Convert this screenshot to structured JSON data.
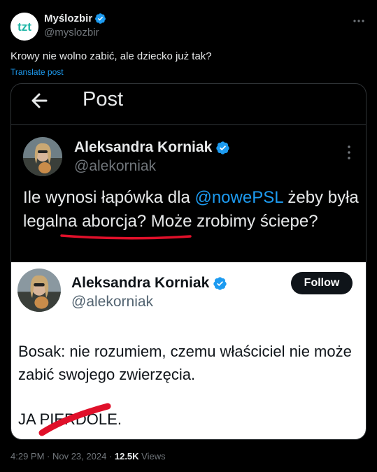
{
  "author": {
    "display_name": "Myślozbir",
    "handle": "@myslozbir",
    "avatar_text": "tzt"
  },
  "tweet": {
    "text": "Krowy nie wolno zabić, ale dziecko już tak?",
    "translate_label": "Translate post"
  },
  "screenshot": {
    "nav_title": "Post",
    "quoted_post": {
      "display_name": "Aleksandra Korniak",
      "handle": "@alekorniak",
      "text_part1": "Ile wynosi łapówka dla ",
      "mention": "@nowePSL",
      "text_part2": " żeby była legalna aborcja? Może zrobimy ściepe?"
    },
    "inner_post": {
      "display_name": "Aleksandra Korniak",
      "handle": "@alekorniak",
      "follow_label": "Follow",
      "text": "Bosak: nie rozumiem, czemu właściciel nie może zabić swojego zwierzęcia.",
      "last_line": "JA PIERDOLE."
    }
  },
  "meta": {
    "timestamp": "4:29 PM · Nov 23, 2024 · ",
    "views_count": "12.5K",
    "views_label": " Views"
  },
  "colors": {
    "accent": "#1d9bf0",
    "verified": "#1d9bf0",
    "red_mark": "#e0102a"
  }
}
